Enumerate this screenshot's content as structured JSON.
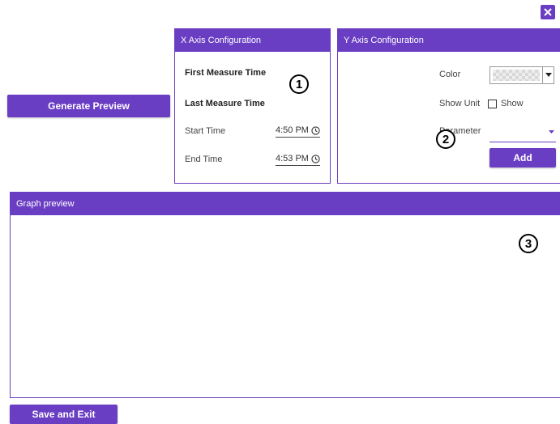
{
  "toolbar": {
    "generate_preview_label": "Generate Preview",
    "save_exit_label": "Save and Exit"
  },
  "x_axis": {
    "title": "X Axis Configuration",
    "first_measure_time": "First Measure Time",
    "last_measure_time": "Last Measure Time",
    "start_time_label": "Start Time",
    "start_time_value": "4:50 PM",
    "end_time_label": "End Time",
    "end_time_value": "4:53 PM",
    "marker": "1"
  },
  "y_axis": {
    "title": "Y Axis Configuration",
    "color_label": "Color",
    "show_unit_label": "Show Unit",
    "show_label": "Show",
    "show_unit_checked": false,
    "parameter_label": "Parameter",
    "parameter_value": "",
    "add_label": "Add",
    "marker": "2"
  },
  "graph": {
    "title": "Graph preview",
    "marker": "3"
  },
  "colors": {
    "accent": "#6a3ec3"
  },
  "icons": [
    "close-icon",
    "clock-icon",
    "chevron-down-icon",
    "caret-down-icon"
  ]
}
